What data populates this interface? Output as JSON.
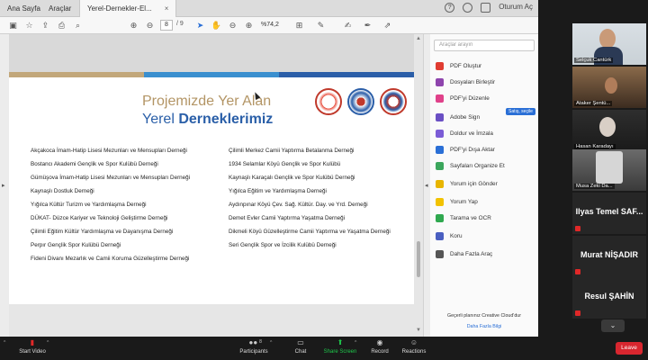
{
  "tabs": [
    {
      "label": "Ana Sayfa"
    },
    {
      "label": "Araçlar"
    },
    {
      "label": "Yerel-Dernekler-El...",
      "close": "×"
    }
  ],
  "topright": {
    "help": "?",
    "bell": "",
    "signin": "Oturum Aç"
  },
  "toolbar": {
    "page_current": "8",
    "page_total": "/ 9",
    "zoom": "%74,2"
  },
  "document": {
    "heading_line1": "Projemizde Yer Alan",
    "heading_line2_a": "Yerel ",
    "heading_line2_b": "Derneklerimiz",
    "left_column": [
      "Akçakoca İmam-Hatip Lisesi Mezunları ve Mensupları Derneği",
      "Bostancı Akademi Gençlik ve Spor Kulübü Derneği",
      "Gümüşova İmam-Hatip Lisesi Mezunları ve Mensupları Derneği",
      "Kaynaşlı Dostluk Derneği",
      "Yığılca Kültür Turizm ve Yardımlaşma Derneği",
      "DÜKAT- Düzce Kariyer ve Teknoloji Geliştirme Derneği",
      "Çilimli Eğitim Kültür Yardımlaşma ve Dayanışma Derneği",
      "Perpır Gençlik Spor Kulübü Derneği",
      "Fideni Divanı Mezarlık ve Camii Koruma Güzelleştirme Derneği"
    ],
    "right_column": [
      "Çilimli Merkez Camii Yaptırma Betalanma Derneği",
      "1934 Selamlar Köyü Gençlik ve Spor Kulübü",
      "Kaynaşlı Karaçalı Gençlik ve Spor Kulübü Derneği",
      "Yığılca Eğitim ve Yardımlaşma Derneği",
      "Aydınpınar Köyü Çev. Sağ. Kültür. Day. ve Yrd. Derneği",
      "Demet Evler Camii Yaptırma Yaşatma Derneği",
      "Dikmeli Köyü Güzelleştirme Camii Yaptırma ve Yaşatma Derneği",
      "Seri Gençlik Spor ve İzcilik Kulübü Derneği"
    ]
  },
  "tools_pane": {
    "search_placeholder": "Araçlar arayın",
    "badge": "Satış, seçile",
    "items": [
      {
        "label": "PDF Oluştur",
        "color": "#e03c31"
      },
      {
        "label": "Dosyaları Birleştir",
        "color": "#8e44ad"
      },
      {
        "label": "PDF'yi Düzenle",
        "color": "#e0418a"
      },
      {
        "label": "Adobe Sign",
        "color": "#6a4fc4"
      },
      {
        "label": "Doldur ve İmzala",
        "color": "#7b5cd6"
      },
      {
        "label": "PDF'yi Dışa Aktar",
        "color": "#2a6fd6"
      },
      {
        "label": "Sayfaları Organize Et",
        "color": "#3ba65c"
      },
      {
        "label": "Yorum için Gönder",
        "color": "#e8b500"
      },
      {
        "label": "Yorum Yap",
        "color": "#f2c200"
      },
      {
        "label": "Tarama ve OCR",
        "color": "#2fa84f"
      },
      {
        "label": "Koru",
        "color": "#4a5fc1"
      },
      {
        "label": "Daha Fazla Araç",
        "color": "#555555"
      }
    ],
    "promo_line1": "Geçerli planınız Creative Cloud'dur",
    "promo_line2": "Daha Fazla Bilgi"
  },
  "participants": {
    "video_tiles": [
      {
        "name": "Selçuk Cantürk"
      },
      {
        "name": "Ataker Şentü..."
      },
      {
        "name": "Hasan Karadayı"
      },
      {
        "name": "Musa Zeki Da..."
      }
    ],
    "name_tiles": [
      {
        "name": "Ilyas Temel SAF..."
      },
      {
        "name": "Murat NİŞADIR"
      },
      {
        "name": "Resul ŞAHİN"
      }
    ]
  },
  "zoom_controls": {
    "start_video": "Start Video",
    "participants": "Participants",
    "participants_count": "8",
    "chat": "Chat",
    "share_screen": "Share Screen",
    "record": "Record",
    "reactions": "Reactions",
    "leave": "Leave"
  }
}
